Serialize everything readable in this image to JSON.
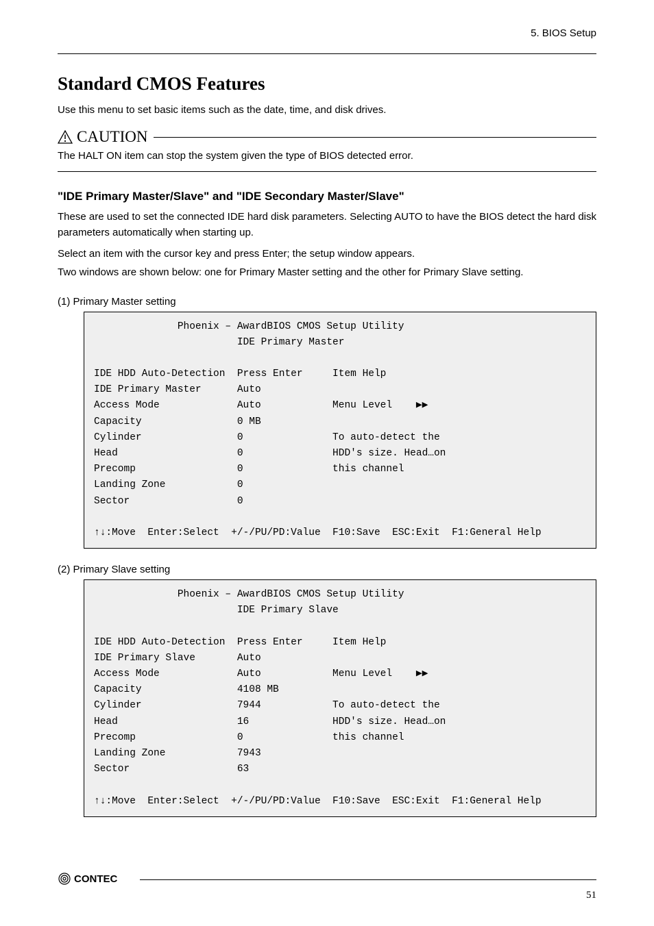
{
  "header": {
    "chapter": "5.  BIOS Setup"
  },
  "section": {
    "title": "Standard CMOS Features",
    "intro": "Use this menu to set basic items such as the date, time, and disk drives.",
    "caution_label": "CAUTION",
    "caution_text": "The HALT ON item can stop the system given the type of BIOS detected error.",
    "subhead": "\"IDE Primary Master/Slave\" and \"IDE Secondary Master/Slave\"",
    "p1": "These are used to set the connected IDE hard disk parameters.  Selecting AUTO to have the BIOS detect the hard disk parameters automatically when starting up.",
    "p2_1": "Select an item with the cursor key and press Enter; the setup window appears.",
    "p2_2": "Two windows are shown below: one for Primary Master setting and the other for Primary Slave setting."
  },
  "screens": {
    "step1_label": "(1)  Primary Master setting",
    "step2_label": "(2)  Primary Slave setting",
    "screen1": {
      "title": "Phoenix – AwardBIOS CMOS Setup Utility",
      "subtitle": "IDE Primary Master",
      "rows": [
        [
          "IDE HDD Auto-Detection",
          "Press Enter",
          "Item Help"
        ],
        [
          "IDE Primary Master",
          "Auto",
          ""
        ],
        [
          "Access Mode",
          "Auto",
          "Menu Level    ▶▶"
        ],
        [
          "Capacity",
          "0 MB",
          ""
        ],
        [
          "Cylinder",
          "0",
          "To auto-detect the"
        ],
        [
          "Head",
          "0",
          "HDD's size. Head…on"
        ],
        [
          "Precomp",
          "0",
          "this channel"
        ],
        [
          "Landing Zone",
          "0",
          ""
        ],
        [
          "Sector",
          "0",
          ""
        ]
      ],
      "footer": "↑↓:Move  Enter:Select  +/-/PU/PD:Value  F10:Save  ESC:Exit  F1:General Help"
    },
    "screen2": {
      "title": "Phoenix – AwardBIOS CMOS Setup Utility",
      "subtitle": "IDE Primary Slave",
      "rows": [
        [
          "IDE HDD Auto-Detection",
          "Press Enter",
          "Item Help"
        ],
        [
          "IDE Primary Slave",
          "Auto",
          ""
        ],
        [
          "Access Mode",
          "Auto",
          "Menu Level    ▶▶"
        ],
        [
          "Capacity",
          "4108 MB",
          ""
        ],
        [
          "Cylinder",
          "7944",
          "To auto-detect the"
        ],
        [
          "Head",
          "16",
          "HDD's size. Head…on"
        ],
        [
          "Precomp",
          "0",
          "this channel"
        ],
        [
          "Landing Zone",
          "7943",
          ""
        ],
        [
          "Sector",
          "63",
          ""
        ]
      ],
      "footer": "↑↓:Move  Enter:Select  +/-/PU/PD:Value  F10:Save  ESC:Exit  F1:General Help"
    }
  },
  "footer": {
    "brand": "CONTEC",
    "page_no": "51"
  }
}
